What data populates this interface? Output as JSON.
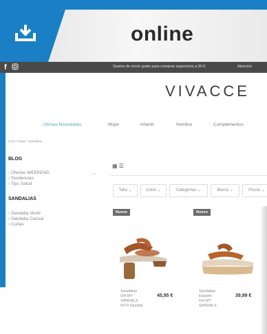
{
  "banner": {
    "title": "online",
    "icon": "download-icon"
  },
  "topbar": {
    "social": [
      "facebook-icon",
      "instagram-icon"
    ],
    "shipping_text": "Gastos de envío gratis para compras superiores a 30 €.",
    "attention_text": "Atención"
  },
  "logo": "VIVACCE",
  "nav": [
    "Últimas Novedades",
    "Mujer",
    "Infantil",
    "Hombre",
    "Complementos"
  ],
  "breadcrumb": "Inicio / Mujer / Sandalias",
  "sidebar": {
    "blog_title": "BLOG",
    "blog_items": [
      "› Ofertas WEEKEND",
      "› Tendencias",
      "› Tips Salud"
    ],
    "sandals_title": "SANDALIAS",
    "sandals_items": [
      "› Sandalia Vestir",
      "› Sandalia Casual",
      "› Cuñas"
    ]
  },
  "filters": [
    "Talla ⌄",
    "Color ⌄",
    "Categorías ⌄",
    "Marca ⌄",
    "Precio ⌄"
  ],
  "products": [
    {
      "badge": "Nuevo",
      "name": "Sandalias\nOH MY\nSANDALS\n5070 Sandlal",
      "price": "45,95 €"
    },
    {
      "badge": "Nuevo",
      "name": "Sandalias\nEsparto\nOH MY\nSANDALS",
      "price": "39,99 €"
    }
  ],
  "colors": {
    "brand_blue": "#1a7fc4",
    "accent_teal": "#4bb0b0",
    "topbar": "#4a4a4a"
  }
}
